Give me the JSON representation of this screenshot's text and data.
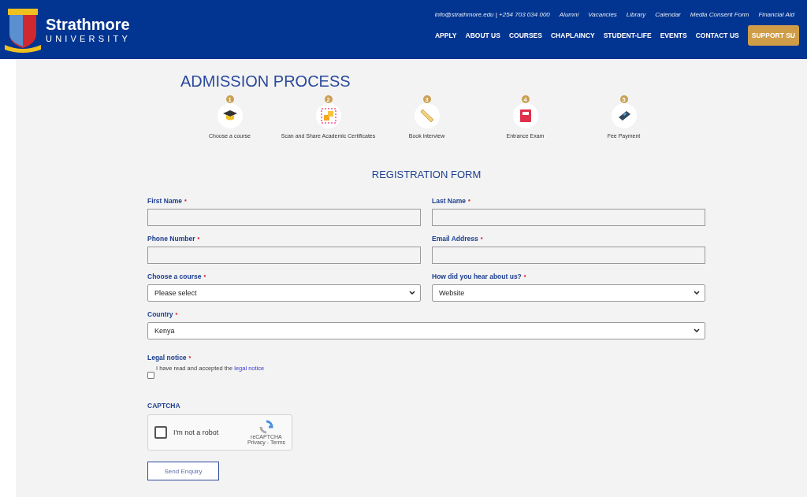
{
  "header": {
    "logo": {
      "name": "Strathmore",
      "subtitle": "UNIVERSITY"
    },
    "top_links": [
      {
        "text": "info@strathmore.edu | +254 703 034 000"
      },
      {
        "text": "Alumni"
      },
      {
        "text": "Vacancies"
      },
      {
        "text": "Library"
      },
      {
        "text": "Calendar"
      },
      {
        "text": "Media Consent Form"
      },
      {
        "text": "Financial Aid"
      }
    ],
    "nav": [
      {
        "label": "APPLY",
        "kind": "link"
      },
      {
        "label": "ABOUT US",
        "kind": "link"
      },
      {
        "label": "COURSES",
        "kind": "link"
      },
      {
        "label": "CHAPLAINCY",
        "kind": "link"
      },
      {
        "label": "STUDENT-LIFE",
        "kind": "link"
      },
      {
        "label": "EVENTS",
        "kind": "link"
      },
      {
        "label": "CONTACT US",
        "kind": "link"
      },
      {
        "label": "SUPPORT SU",
        "kind": "button"
      }
    ]
  },
  "admission": {
    "title": "ADMISSION PROCESS",
    "steps": [
      {
        "number": "1",
        "label": "Choose a course",
        "kind": "cap"
      },
      {
        "number": "2",
        "label": "Scan and Share Academic Certificates",
        "kind": "scan"
      },
      {
        "number": "3",
        "label": "Book interview",
        "kind": "ruler"
      },
      {
        "number": "4",
        "label": "Entrance Exam",
        "kind": "book"
      },
      {
        "number": "5",
        "label": "Fee Payment",
        "kind": "card"
      }
    ]
  },
  "form": {
    "title": "REGISTRATION FORM",
    "fields": [
      {
        "label": "First Name",
        "required_mark": "*",
        "kind": "text"
      },
      {
        "label": "Last Name",
        "required_mark": "*",
        "kind": "text"
      },
      {
        "label": "Phone Number",
        "required_mark": "*",
        "kind": "text"
      },
      {
        "label": "Email Address",
        "required_mark": "*",
        "kind": "text"
      },
      {
        "label": "Choose a course",
        "required_mark": "*",
        "kind": "select",
        "value": "Please select"
      },
      {
        "label": "How did you hear about us?",
        "required_mark": "*",
        "kind": "select",
        "value": "Website"
      },
      {
        "label": "Country",
        "required_mark": "*",
        "kind": "select",
        "value": "Kenya"
      }
    ],
    "legal": {
      "label": "Legal notice",
      "required_mark": "*",
      "text": "I have read and accepted the",
      "link": "legal notice",
      "checked": false
    },
    "captcha": {
      "label": "CAPTCHA",
      "text": "I'm not a robot",
      "checked": false,
      "brand": "reCAPTCHA",
      "links": "Privacy - Terms"
    },
    "submit": "Send Enquiry"
  }
}
